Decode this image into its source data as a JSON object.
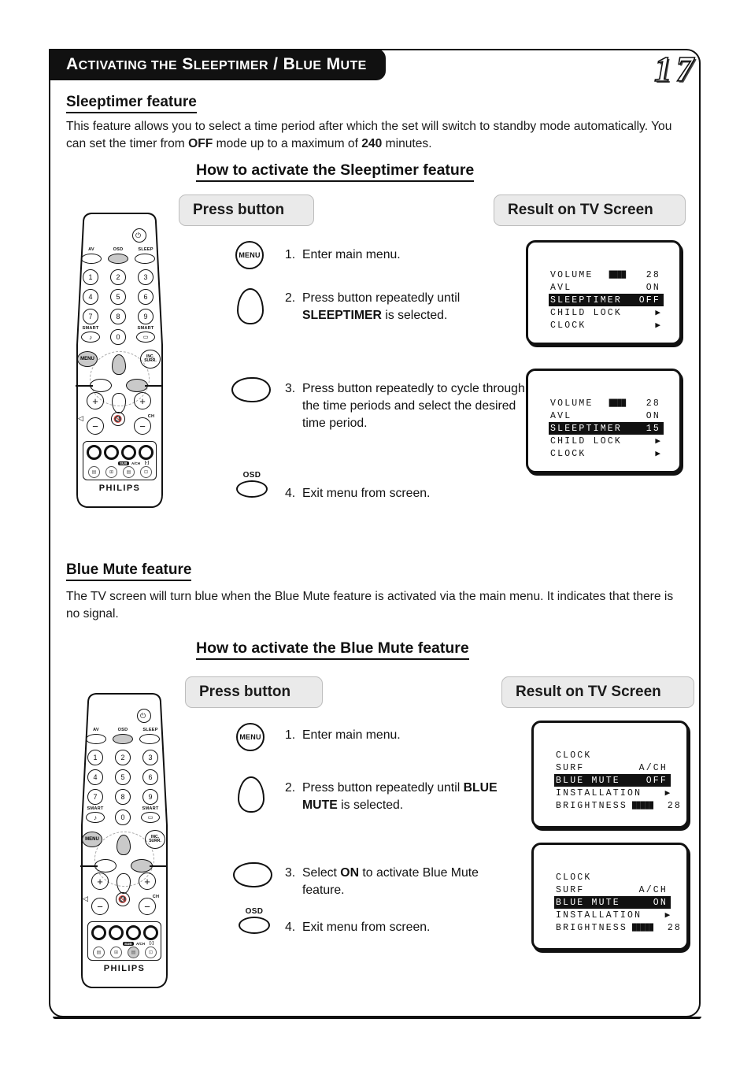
{
  "header": {
    "title_small_a": "A",
    "title": "CTIVATING THE SLEEPTIMER / BLUE MUTE",
    "title_full": "Activating the Sleeptimer / Blue Mute",
    "page_number": "17"
  },
  "sleeptimer": {
    "heading": "Sleeptimer feature",
    "description": "This feature allows you to select a time period after which the set will switch to standby mode automatically. You can set the timer from OFF mode up to a maximum of 240 minutes.",
    "desc_part1": "This feature allows you to select a time period after which the set will switch to standby mode automatically. You can set the timer from ",
    "desc_bold1": "OFF",
    "desc_part2": " mode up to a maximum of ",
    "desc_bold2": "240",
    "desc_part3": " minutes.",
    "how_to": "How to activate the Sleeptimer feature",
    "col_press": "Press button",
    "col_result": "Result on TV Screen",
    "steps": [
      {
        "num": "1.",
        "text": "Enter main menu.",
        "icon": "menu-button-icon"
      },
      {
        "num": "2.",
        "text_pre": "Press button repeatedly until ",
        "bold": "SLEEPTIMER",
        "text_post": " is selected.",
        "icon": "cursor-up-button-icon"
      },
      {
        "num": "3.",
        "text_pre": "Press button repeatedly to cycle through the time periods and select the desired time period.",
        "bold": "",
        "text_post": "",
        "icon": "cursor-right-button-icon"
      },
      {
        "num": "4.",
        "text": "Exit menu from screen.",
        "icon": "osd-button-icon",
        "icon_label": "OSD"
      }
    ],
    "tv_screen_1": {
      "rows": [
        {
          "label": "VOLUME",
          "bars": "████",
          "value": "28",
          "highlight": false
        },
        {
          "label": "AVL",
          "bars": "",
          "value": "ON",
          "highlight": false
        },
        {
          "label": "SLEEPTIMER",
          "bars": "",
          "value": "OFF",
          "highlight": true
        },
        {
          "label": "CHILD LOCK",
          "bars": "",
          "value": "▶",
          "highlight": false
        },
        {
          "label": "CLOCK",
          "bars": "",
          "value": "▶",
          "highlight": false
        }
      ]
    },
    "tv_screen_2": {
      "rows": [
        {
          "label": "VOLUME",
          "bars": "████",
          "value": "28",
          "highlight": false
        },
        {
          "label": "AVL",
          "bars": "",
          "value": "ON",
          "highlight": false
        },
        {
          "label": "SLEEPTIMER",
          "bars": "",
          "value": "15",
          "highlight": true
        },
        {
          "label": "CHILD LOCK",
          "bars": "",
          "value": "▶",
          "highlight": false
        },
        {
          "label": "CLOCK",
          "bars": "",
          "value": "▶",
          "highlight": false
        }
      ]
    }
  },
  "bluemute": {
    "heading": "Blue Mute feature",
    "description": "The TV screen will turn blue when the Blue Mute feature is activated via the main menu. It indicates that there is no signal.",
    "how_to": "How to activate the Blue Mute feature",
    "col_press": "Press button",
    "col_result": "Result on TV Screen",
    "steps": [
      {
        "num": "1.",
        "text": "Enter main menu.",
        "icon": "menu-button-icon"
      },
      {
        "num": "2.",
        "text_pre": "Press button repeatedly until ",
        "bold": "BLUE MUTE",
        "text_post": " is selected.",
        "icon": "cursor-up-button-icon"
      },
      {
        "num": "3.",
        "text_pre": "Select ",
        "bold": "ON",
        "text_post": " to activate Blue Mute feature.",
        "icon": "cursor-right-button-icon"
      },
      {
        "num": "4.",
        "text": "Exit menu from screen.",
        "icon": "osd-button-icon",
        "icon_label": "OSD"
      }
    ],
    "tv_screen_1": {
      "rows": [
        {
          "label": "CLOCK",
          "bars": "",
          "value": "",
          "highlight": false
        },
        {
          "label": "SURF",
          "bars": "",
          "value": "A/CH",
          "highlight": false
        },
        {
          "label": "BLUE MUTE",
          "bars": "",
          "value": "OFF",
          "highlight": true
        },
        {
          "label": "INSTALLATION",
          "bars": "",
          "value": "▶",
          "highlight": false
        },
        {
          "label": "BRIGHTNESS",
          "bars": "█████",
          "value": "28",
          "highlight": false
        }
      ]
    },
    "tv_screen_2": {
      "rows": [
        {
          "label": "CLOCK",
          "bars": "",
          "value": "",
          "highlight": false
        },
        {
          "label": "SURF",
          "bars": "",
          "value": "A/CH",
          "highlight": false
        },
        {
          "label": "BLUE MUTE",
          "bars": "",
          "value": "ON",
          "highlight": true
        },
        {
          "label": "INSTALLATION",
          "bars": "",
          "value": "▶",
          "highlight": false
        },
        {
          "label": "BRIGHTNESS",
          "bars": "█████",
          "value": "28",
          "highlight": false
        }
      ]
    }
  },
  "remote": {
    "brand": "PHILIPS",
    "labels": {
      "av": "AV",
      "osd": "OSD",
      "sleep": "SLEEP",
      "smart_left": "SMART",
      "smart_right": "SMART",
      "menu": "MENU",
      "inc_surr_1": "INC.",
      "inc_surr_2": "SURR.",
      "ch": "CH",
      "subtitle": "SUB",
      "ach": "A/CH",
      "size": "[-]"
    },
    "keypad": [
      "1",
      "2",
      "3",
      "4",
      "5",
      "6",
      "7",
      "8",
      "9",
      "0"
    ],
    "menu_button_text": "MENU"
  },
  "colors": {
    "ink": "#111111",
    "pill_bg": "#eaeaea",
    "pill_border": "#bdbdbd",
    "key_highlight": "#c9c9c9"
  }
}
